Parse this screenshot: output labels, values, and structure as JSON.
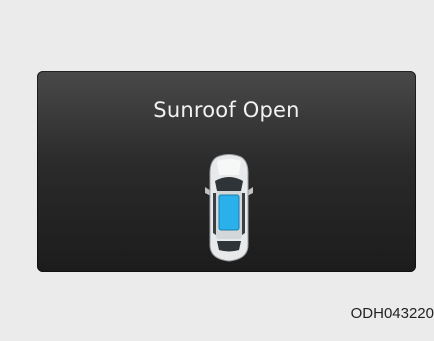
{
  "display": {
    "message": "Sunroof Open",
    "icon": "car-top-view-sunroof-open-icon",
    "colors": {
      "panel": "#2c2c2c",
      "text": "#f2f2f2",
      "sunroof": "#2ab0ea"
    }
  },
  "figure": {
    "code": "ODH043220"
  }
}
